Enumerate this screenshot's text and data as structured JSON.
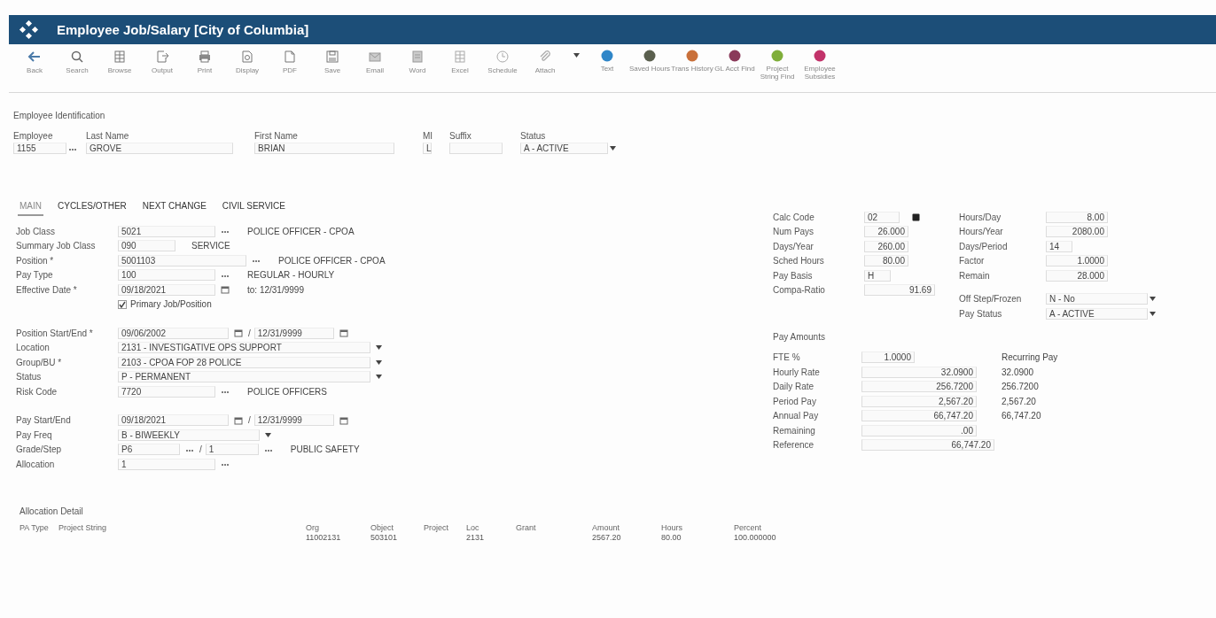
{
  "window": {
    "title": "Employee Job/Salary [City of Columbia]"
  },
  "toolbar": [
    {
      "label": "Back",
      "kind": "back"
    },
    {
      "label": "Search",
      "kind": "search"
    },
    {
      "label": "Browse",
      "kind": "browse"
    },
    {
      "label": "Output",
      "kind": "output"
    },
    {
      "label": "Print",
      "kind": "print"
    },
    {
      "label": "Display",
      "kind": "display"
    },
    {
      "label": "PDF",
      "kind": "doc"
    },
    {
      "label": "Save",
      "kind": "save"
    },
    {
      "label": "Email",
      "kind": "email"
    },
    {
      "label": "Word",
      "kind": "word"
    },
    {
      "label": "Excel",
      "kind": "excel"
    },
    {
      "label": "Schedule",
      "kind": "schedule"
    },
    {
      "label": "Attach",
      "kind": "attach"
    },
    {
      "kind": "caret"
    },
    {
      "label": "Text",
      "kind": "dot",
      "color": "#2f86c8"
    },
    {
      "label": "Saved Hours",
      "kind": "dot",
      "color": "#5a5f4e"
    },
    {
      "label": "Trans History",
      "kind": "dot",
      "color": "#c9703a"
    },
    {
      "label": "GL Acct Find",
      "kind": "dot",
      "color": "#8a3a5a"
    },
    {
      "label": "Project String Find",
      "kind": "dot",
      "color": "#7fae3a"
    },
    {
      "label": "Employee Subsidies",
      "kind": "dot",
      "color": "#c2336a"
    }
  ],
  "identification": {
    "heading": "Employee Identification",
    "fields": [
      {
        "label": "Employee",
        "value": "1155",
        "kind": "lookup"
      },
      {
        "label": "Last Name",
        "value": "GROVE",
        "kind": "text"
      },
      {
        "label": "First Name",
        "value": "BRIAN",
        "kind": "text"
      },
      {
        "label": "MI",
        "value": "L",
        "kind": "short"
      },
      {
        "label": "Suffix",
        "kind": "text"
      },
      {
        "label": "Status",
        "value": "A - ACTIVE",
        "kind": "select"
      }
    ]
  },
  "tabs": [
    {
      "label": "MAIN",
      "selected": true
    },
    {
      "label": "CYCLES/OTHER",
      "selected": false
    },
    {
      "label": "NEXT CHANGE",
      "selected": false
    },
    {
      "label": "CIVIL SERVICE",
      "selected": false
    }
  ],
  "main_form": {
    "sections": [
      {
        "rows": [
          {
            "label": "Job Class",
            "kind": "lookup",
            "value": "5021",
            "description": "POLICE OFFICER - CPOA"
          },
          {
            "label": "Summary Job Class",
            "kind": "text",
            "value": "090",
            "description": "SERVICE"
          },
          {
            "label": "Position *",
            "kind": "lookup_wide",
            "value": "5001103",
            "description": "POLICE OFFICER - CPOA"
          },
          {
            "label": "Pay Type",
            "kind": "lookup",
            "value": "100",
            "description": "REGULAR - HOURLY"
          },
          {
            "label": "Effective Date *",
            "kind": "date",
            "value": "09/18/2021",
            "description": "to: 12/31/9999"
          },
          {
            "kind": "check",
            "text": "Primary Job/Position",
            "checked": true
          }
        ]
      },
      {
        "rows": [
          {
            "label": "Position Start/End *",
            "kind": "range",
            "value": "09/06/2002",
            "separator": "/",
            "value_end": "12/31/9999"
          },
          {
            "label": "Location",
            "kind": "select",
            "value": "2131 - INVESTIGATIVE OPS SUPPORT"
          },
          {
            "label": "Group/BU *",
            "kind": "select",
            "value": "2103 - CPOA FOP 28 POLICE"
          },
          {
            "label": "Status",
            "kind": "select",
            "value": "P - PERMANENT"
          },
          {
            "label": "Risk Code",
            "kind": "lookup",
            "value": "7720",
            "description": "POLICE OFFICERS"
          }
        ]
      },
      {
        "rows": [
          {
            "label": "Pay Start/End",
            "kind": "range",
            "value": "09/18/2021",
            "separator": "/",
            "value_end": "12/31/9999"
          },
          {
            "label": "Pay Freq",
            "kind": "select_short",
            "value": "B - BIWEEKLY"
          },
          {
            "label": "Grade/Step",
            "kind": "grade",
            "value": "P6",
            "separator": "/",
            "value_end": "1",
            "description": "PUBLIC SAFETY"
          },
          {
            "label": "Allocation",
            "kind": "lookup_short",
            "value": "1"
          }
        ]
      }
    ]
  },
  "calc": {
    "left": [
      {
        "label": "Calc Code",
        "value": "02",
        "kind": "button"
      },
      {
        "label": "Num Pays",
        "value": "26.000",
        "kind": "number"
      },
      {
        "label": "Days/Year",
        "value": "260.00",
        "kind": "number"
      },
      {
        "label": "Sched Hours",
        "value": "80.00",
        "kind": "number"
      },
      {
        "label": "Pay Basis",
        "value": "H",
        "kind": "text"
      },
      {
        "label": "Compa-Ratio",
        "value": "91.69",
        "kind": "wide"
      }
    ],
    "right": [
      {
        "label": "Hours/Day",
        "value": "8.00",
        "kind": "number"
      },
      {
        "label": "Hours/Year",
        "value": "2080.00",
        "kind": "number"
      },
      {
        "label": "Days/Period",
        "value": "14",
        "kind": "text"
      },
      {
        "label": "Factor",
        "value": "1.0000",
        "kind": "number"
      },
      {
        "label": "Remain",
        "value": "28.000",
        "kind": "number"
      }
    ],
    "selects": [
      {
        "label": "Off Step/Frozen",
        "value": "N - No"
      },
      {
        "label": "Pay Status",
        "value": "A - ACTIVE"
      }
    ]
  },
  "pay_amounts": {
    "heading": "Pay Amounts",
    "recurring_heading": "Recurring Pay",
    "rows": [
      {
        "label": "FTE %",
        "value": "1.0000",
        "kind": "short"
      },
      {
        "label": "Hourly Rate",
        "value": "32.0900",
        "recurring": "32.0900",
        "kind": "number"
      },
      {
        "label": "Daily Rate",
        "value": "256.7200",
        "recurring": "256.7200",
        "kind": "number"
      },
      {
        "label": "Period Pay",
        "value": "2,567.20",
        "recurring": "2,567.20",
        "kind": "number"
      },
      {
        "label": "Annual Pay",
        "value": "66,747.20",
        "recurring": "66,747.20",
        "kind": "number"
      },
      {
        "label": "Remaining",
        "value": ".00",
        "kind": "number"
      },
      {
        "label": "Reference",
        "value": "66,747.20",
        "kind": "wide"
      }
    ]
  },
  "allocation": {
    "heading": "Allocation Detail",
    "columns": [
      "PA Type",
      "Project String",
      "Org",
      "Object",
      "Project",
      "Loc",
      "Grant",
      "Amount",
      "Hours",
      "Percent"
    ],
    "rows": [
      {
        "cells": [
          null,
          null,
          "11002131",
          "503101",
          null,
          "2131",
          null,
          "2567.20",
          "80.00",
          "100.000000"
        ]
      }
    ]
  }
}
